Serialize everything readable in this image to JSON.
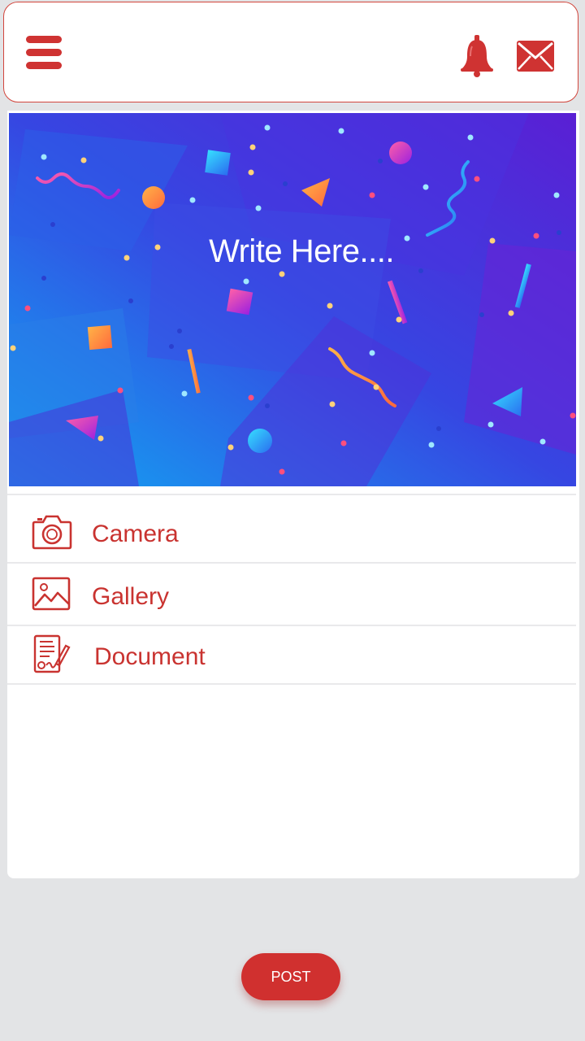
{
  "header": {
    "menu_icon": "hamburger-menu-icon",
    "notification_icon": "bell-icon",
    "message_icon": "envelope-icon",
    "accent_color": "#cf3332"
  },
  "composer": {
    "placeholder": "Write Here....",
    "gradient_colors": [
      "#1aa0f0",
      "#3d3ee0",
      "#6a1ad8"
    ]
  },
  "attach_options": [
    {
      "label": "Camera",
      "icon": "camera-icon"
    },
    {
      "label": "Gallery",
      "icon": "image-icon"
    },
    {
      "label": "Document",
      "icon": "document-icon"
    }
  ],
  "actions": {
    "post_label": "POST",
    "post_color": "#d0302f"
  }
}
